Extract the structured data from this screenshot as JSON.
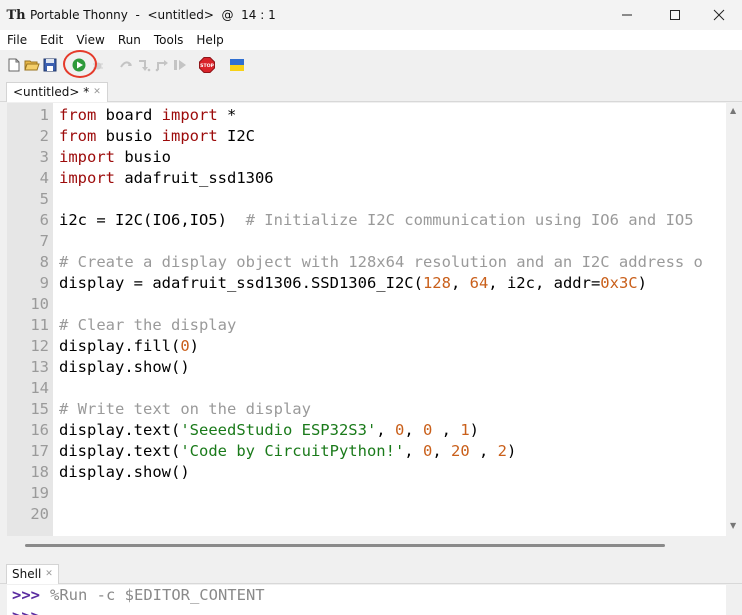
{
  "window": {
    "title": "Portable Thonny  -  <untitled>  @  14 : 1",
    "app_icon_glyph": "Th"
  },
  "menu": [
    "File",
    "Edit",
    "View",
    "Run",
    "Tools",
    "Help"
  ],
  "toolbar": {
    "icons": [
      "new-file-icon",
      "open-file-icon",
      "save-icon",
      "run-icon",
      "debug-icon",
      "step-over-icon",
      "step-into-icon",
      "step-out-icon",
      "resume-icon",
      "stop-icon",
      "ukraine-flag-icon"
    ],
    "stop_label": "STOP",
    "highlight_color": "#e53a2a"
  },
  "editor": {
    "tab_label": "<untitled> *",
    "line_numbers": [
      "1",
      "2",
      "3",
      "4",
      "5",
      "6",
      "7",
      "8",
      "9",
      "10",
      "11",
      "12",
      "13",
      "14",
      "15",
      "16",
      "17",
      "18",
      "19",
      "20"
    ],
    "lines": {
      "l1": {
        "a": "from",
        "b": " board ",
        "c": "import",
        "d": " *"
      },
      "l2": {
        "a": "from",
        "b": " busio ",
        "c": "import",
        "d": " I2C"
      },
      "l3": {
        "a": "import",
        "b": " busio"
      },
      "l4": {
        "a": "import",
        "b": " adafruit_ssd1306"
      },
      "l6": {
        "a": "i2c = I2C(IO6,IO5)  ",
        "b": "# Initialize I2C communication using IO6 and IO5"
      },
      "l8": {
        "a": "# Create a display object with 128x64 resolution and an I2C address o"
      },
      "l9": {
        "a": "display = adafruit_ssd1306.SSD1306_I2C(",
        "b": "128",
        "c": ", ",
        "d": "64",
        "e": ", i2c, addr=",
        "f": "0x3C",
        "g": ")"
      },
      "l11": {
        "a": "# Clear the display"
      },
      "l12": {
        "a": "display.fill(",
        "b": "0",
        "c": ")"
      },
      "l13": {
        "a": "display.show()"
      },
      "l15": {
        "a": "# Write text on the display"
      },
      "l16": {
        "a": "display.text(",
        "b": "'SeeedStudio ESP32S3'",
        "c": ", ",
        "d": "0",
        "e": ", ",
        "f": "0",
        "g": " , ",
        "h": "1",
        "i": ")"
      },
      "l17": {
        "a": "display.text(",
        "b": "'Code by CircuitPython!'",
        "c": ", ",
        "d": "0",
        "e": ", ",
        "f": "20",
        "g": " , ",
        "h": "2",
        "i": ")"
      },
      "l18": {
        "a": "display.show()"
      }
    }
  },
  "shell": {
    "tab_label": "Shell",
    "prompt": ">>>",
    "command": "%Run -c $EDITOR_CONTENT"
  }
}
